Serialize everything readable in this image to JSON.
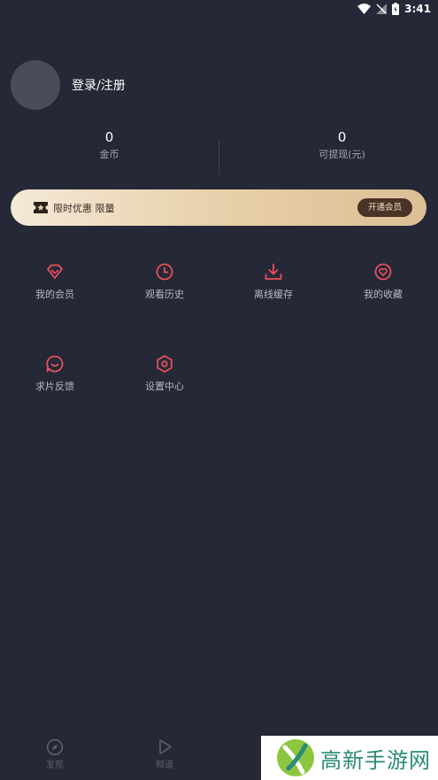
{
  "status_bar": {
    "time": "3:41"
  },
  "profile": {
    "login_label": "登录/注册"
  },
  "stats": [
    {
      "value": "0",
      "label": "金币"
    },
    {
      "value": "0",
      "label": "可提现(元)"
    }
  ],
  "vip_banner": {
    "text": "限时优惠 限量",
    "button_label": "开通会员"
  },
  "menu": [
    {
      "label": "我的会员",
      "icon": "diamond-icon"
    },
    {
      "label": "观看历史",
      "icon": "clock-icon"
    },
    {
      "label": "离线缓存",
      "icon": "download-icon"
    },
    {
      "label": "我的收藏",
      "icon": "heart-icon"
    },
    {
      "label": "求片反馈",
      "icon": "chat-icon"
    },
    {
      "label": "设置中心",
      "icon": "settings-icon"
    }
  ],
  "tabbar": [
    {
      "label": "发现",
      "icon": "compass-icon"
    },
    {
      "label": "频道",
      "icon": "play-icon"
    }
  ],
  "watermark": {
    "text": "高新手游网"
  },
  "colors": {
    "background": "#252836",
    "accent": "#e8505b",
    "vip_gold": "#e9d2ae"
  }
}
